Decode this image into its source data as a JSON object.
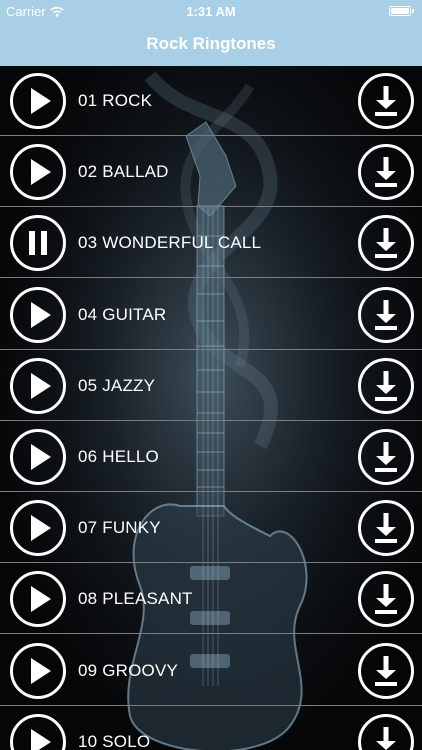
{
  "status_bar": {
    "carrier": "Carrier",
    "time": "1:31 AM",
    "wifi_icon": "wifi-icon",
    "battery_icon": "battery-icon",
    "battery_level": 1.0
  },
  "nav": {
    "title": "Rock Ringtones"
  },
  "colors": {
    "nav_background": "#a9cfe6",
    "text": "#ffffff",
    "list_background": "#050607",
    "separator": "#7d7d7d"
  },
  "ringtones": [
    {
      "label": "01 ROCK",
      "playback_icon": "play-icon",
      "download_icon": "download-icon"
    },
    {
      "label": "02 BALLAD",
      "playback_icon": "play-icon",
      "download_icon": "download-icon"
    },
    {
      "label": "03 WONDERFUL CALL",
      "playback_icon": "pause-icon",
      "download_icon": "download-icon"
    },
    {
      "label": "04 GUITAR",
      "playback_icon": "play-icon",
      "download_icon": "download-icon"
    },
    {
      "label": "05 JAZZY",
      "playback_icon": "play-icon",
      "download_icon": "download-icon"
    },
    {
      "label": "06 HELLO",
      "playback_icon": "play-icon",
      "download_icon": "download-icon"
    },
    {
      "label": "07 FUNKY",
      "playback_icon": "play-icon",
      "download_icon": "download-icon"
    },
    {
      "label": "08 PLEASANT",
      "playback_icon": "play-icon",
      "download_icon": "download-icon"
    },
    {
      "label": "09 GROOVY",
      "playback_icon": "play-icon",
      "download_icon": "download-icon"
    },
    {
      "label": "10 SOLO",
      "playback_icon": "play-icon",
      "download_icon": "download-icon"
    }
  ]
}
